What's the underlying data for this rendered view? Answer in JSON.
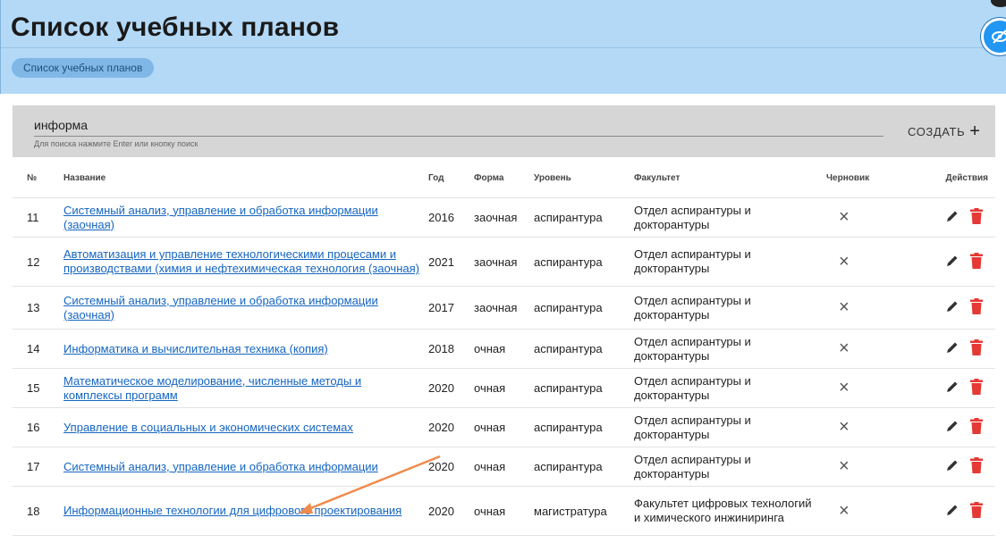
{
  "page": {
    "title": "Список учебных планов",
    "breadcrumb": "Список учебных планов"
  },
  "search": {
    "value": "информа",
    "hint": "Для поиска нажмите Enter или кнопку поиск",
    "create_label": "СОЗДАТЬ",
    "create_icon": "plus-icon"
  },
  "table": {
    "headers": [
      "№",
      "Название",
      "Год",
      "Форма",
      "Уровень",
      "Факультет",
      "Черновик",
      "Действия"
    ],
    "rows": [
      {
        "num": "11",
        "name": "Системный анализ, управление и обработка информации (заочная)",
        "year": "2016",
        "form": "заочная",
        "level": "аспирантура",
        "faculty": "Отдел аспирантуры и докторантуры",
        "draft": "×"
      },
      {
        "num": "12",
        "name": "Автоматизация и управление технологическими процесами и производствами (химия и нефтехимическая технология (заочная)",
        "year": "2021",
        "form": "заочная",
        "level": "аспирантура",
        "faculty": "Отдел аспирантуры и докторантуры",
        "draft": "×"
      },
      {
        "num": "13",
        "name": "Системный анализ, управление и обработка информации (заочная)",
        "year": "2017",
        "form": "заочная",
        "level": "аспирантура",
        "faculty": "Отдел аспирантуры и докторантуры",
        "draft": "×"
      },
      {
        "num": "14",
        "name": "Информатика и вычислительная техника (копия)",
        "year": "2018",
        "form": "очная",
        "level": "аспирантура",
        "faculty": "Отдел аспирантуры и докторантуры",
        "draft": "×"
      },
      {
        "num": "15",
        "name": "Математическое моделирование, численные методы и комплексы программ",
        "year": "2020",
        "form": "очная",
        "level": "аспирантура",
        "faculty": "Отдел аспирантуры и докторантуры",
        "draft": "×"
      },
      {
        "num": "16",
        "name": "Управление в социальных и экономических системах",
        "year": "2020",
        "form": "очная",
        "level": "аспирантура",
        "faculty": "Отдел аспирантуры и докторантуры",
        "draft": "×"
      },
      {
        "num": "17",
        "name": "Системный анализ, управление и обработка информации",
        "year": "2020",
        "form": "очная",
        "level": "аспирантура",
        "faculty": "Отдел аспирантуры и докторантуры",
        "draft": "×"
      },
      {
        "num": "18",
        "name": "Информационные технологии для цифрового проектирования",
        "year": "2020",
        "form": "очная",
        "level": "магистратура",
        "faculty": "Факультет цифровых технологий и химического инжиниринга",
        "draft": "×"
      }
    ]
  },
  "icons": {
    "edit": "pencil-icon",
    "delete": "trash-icon",
    "corner": "eye-slash-icon"
  },
  "colors": {
    "header_bg": "#b3d9f7",
    "link": "#1565c0",
    "delete": "#e53935",
    "accent": "#2196f3",
    "annotation_arrow": "#f08a4b"
  }
}
